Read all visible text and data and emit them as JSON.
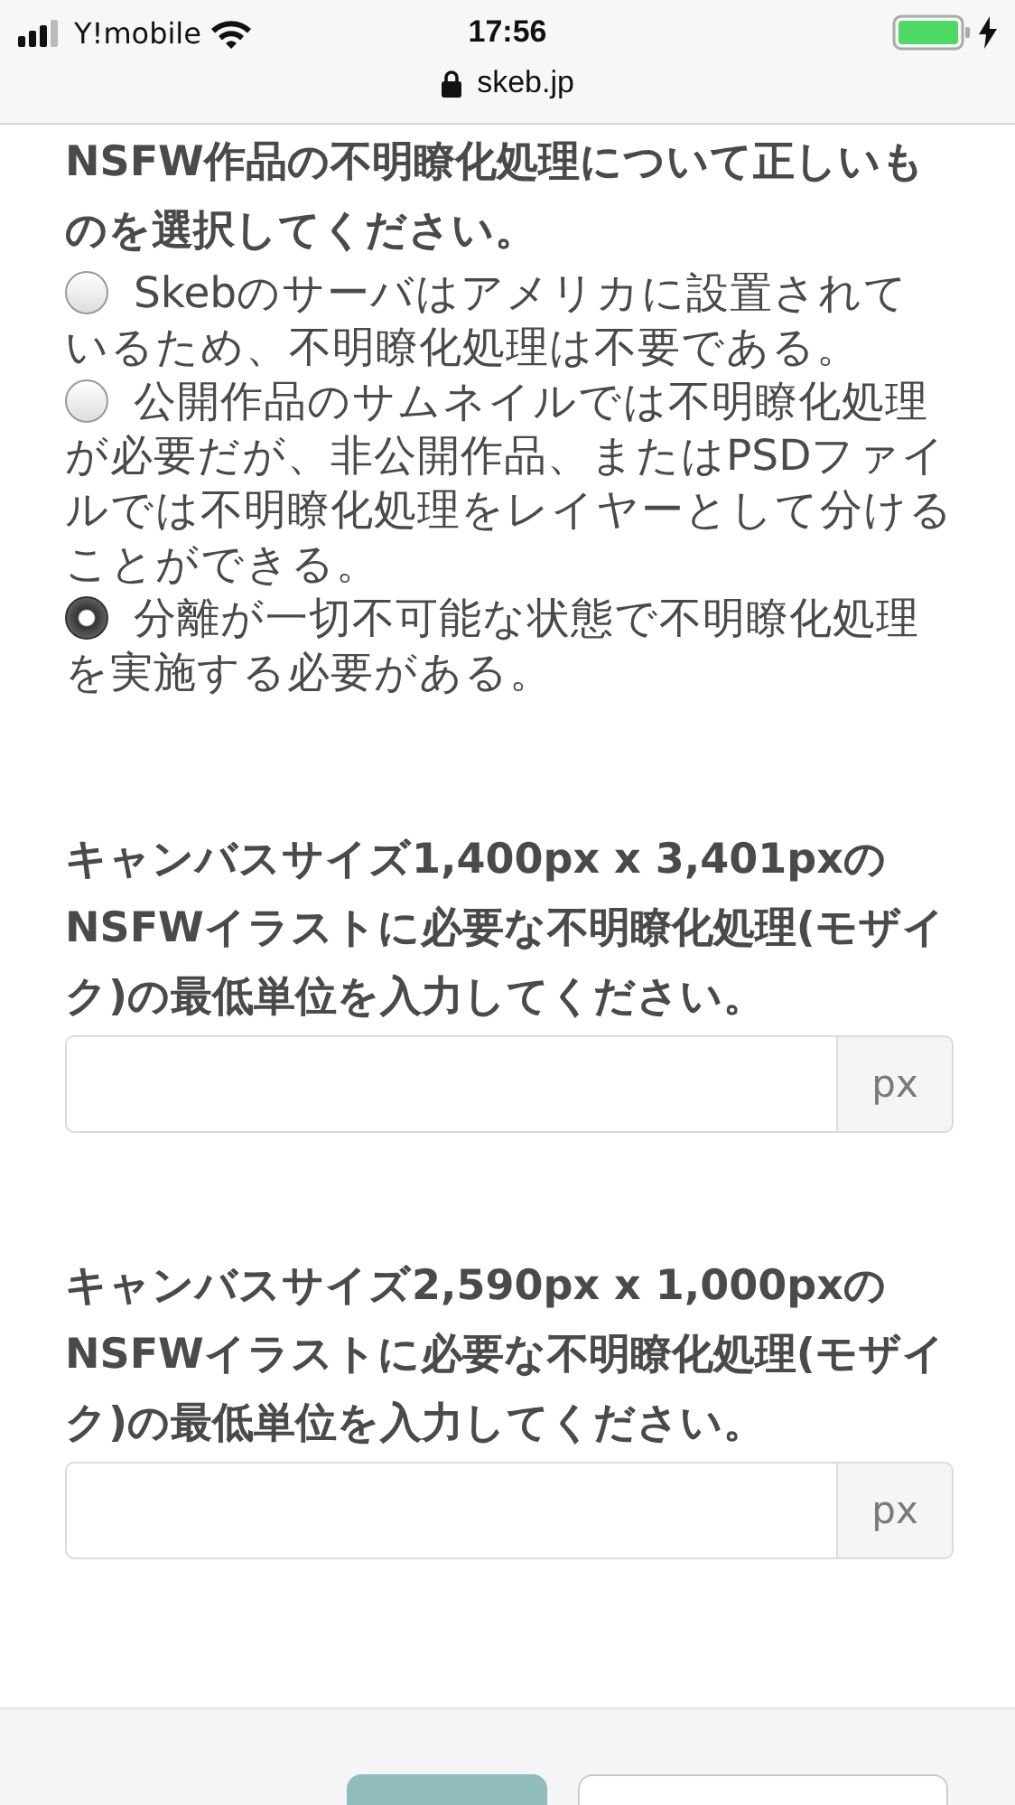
{
  "status_bar": {
    "carrier": "Y!mobile",
    "time": "17:56",
    "url": "skeb.jp"
  },
  "questions": [
    {
      "kind": "radio",
      "title": "NSFW作品の不明瞭化処理について正しいものを選択してください。",
      "options": [
        {
          "label": "Skebのサーバはアメリカに設置されているため、不明瞭化処理は不要である。",
          "selected": false
        },
        {
          "label": "公開作品のサムネイルでは不明瞭化処理が必要だが、非公開作品、またはPSDファイルでは不明瞭化処理をレイヤーとして分けることができる。",
          "selected": false
        },
        {
          "label": "分離が一切不可能な状態で不明瞭化処理を実施する必要がある。",
          "selected": true
        }
      ]
    },
    {
      "kind": "number",
      "title": "キャンバスサイズ1,400px x 3,401pxのNSFWイラストに必要な不明瞭化処理(モザイク)の最低単位を入力してください。",
      "unit": "px"
    },
    {
      "kind": "number",
      "title": "キャンバスサイズ2,590px x 1,000pxのNSFWイラストに必要な不明瞭化処理(モザイク)の最低単位を入力してください。",
      "unit": "px"
    }
  ]
}
